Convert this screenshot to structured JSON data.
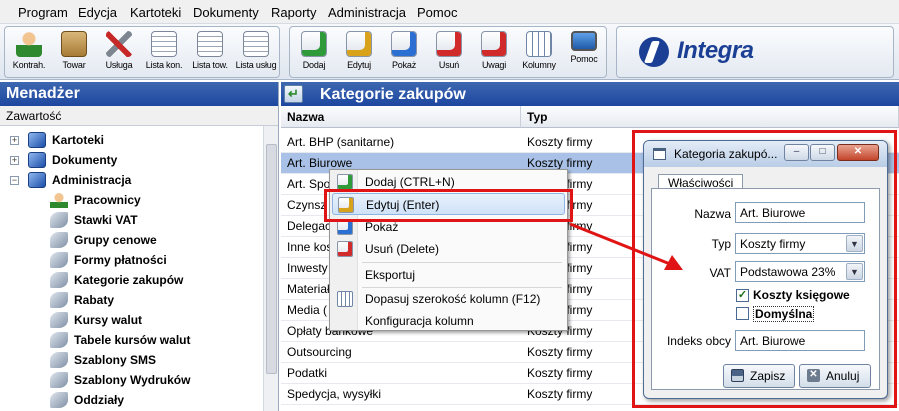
{
  "menubar": {
    "items": [
      "Program",
      "Edycja",
      "Kartoteki",
      "Dokumenty",
      "Raporty",
      "Administracja",
      "Pomoc"
    ]
  },
  "toolbar": {
    "group1": [
      {
        "label": "Kontrah.",
        "icon": "contractor-person-icon"
      },
      {
        "label": "Towar",
        "icon": "goods-box-icon"
      },
      {
        "label": "Usługa",
        "icon": "service-tools-icon"
      },
      {
        "label": "Lista kon.",
        "icon": "contractor-list-icon"
      },
      {
        "label": "Lista tow.",
        "icon": "goods-list-icon"
      },
      {
        "label": "Lista usług",
        "icon": "service-list-icon"
      }
    ],
    "group2": [
      {
        "label": "Dodaj",
        "icon": "add-icon"
      },
      {
        "label": "Edytuj",
        "icon": "edit-icon"
      },
      {
        "label": "Pokaż",
        "icon": "show-icon"
      },
      {
        "label": "Usuń",
        "icon": "delete-icon"
      },
      {
        "label": "Uwagi",
        "icon": "notes-icon"
      },
      {
        "label": "Kolumny",
        "icon": "columns-icon"
      },
      {
        "label": "Pomoc",
        "icon": "help-monitor-icon"
      }
    ],
    "brand": "Integra"
  },
  "left_panel": {
    "title": "Menadżer",
    "subtitle": "Zawartość",
    "tree": [
      {
        "label": "Kartoteki",
        "level": 0,
        "expander": "+"
      },
      {
        "label": "Dokumenty",
        "level": 0,
        "expander": "+"
      },
      {
        "label": "Administracja",
        "level": 0,
        "expander": "−"
      },
      {
        "label": "Pracownicy",
        "level": 1
      },
      {
        "label": "Stawki VAT",
        "level": 1
      },
      {
        "label": "Grupy cenowe",
        "level": 1
      },
      {
        "label": "Formy płatności",
        "level": 1
      },
      {
        "label": "Kategorie zakupów",
        "level": 1
      },
      {
        "label": "Rabaty",
        "level": 1
      },
      {
        "label": "Kursy walut",
        "level": 1
      },
      {
        "label": "Tabele kursów walut",
        "level": 1
      },
      {
        "label": "Szablony SMS",
        "level": 1
      },
      {
        "label": "Szablony Wydruków",
        "level": 1
      },
      {
        "label": "Oddziały",
        "level": 1
      }
    ]
  },
  "right_panel": {
    "title": "Kategorie zakupów",
    "columns": [
      "Nazwa",
      "Typ"
    ],
    "rows": [
      {
        "name": "Art. BHP (sanitarne)",
        "type": "Koszty firmy"
      },
      {
        "name": "Art. Biurowe",
        "type": "Koszty firmy",
        "selected": true
      },
      {
        "name": "Art. Spo",
        "type": "Koszty firmy"
      },
      {
        "name": "Czynsz",
        "type": "Koszty firmy"
      },
      {
        "name": "Delegac",
        "type": "Koszty firmy"
      },
      {
        "name": "Inne kos",
        "type": "Koszty firmy"
      },
      {
        "name": "Inwesty",
        "type": "Koszty firmy"
      },
      {
        "name": "Materiał",
        "type": "Koszty firmy"
      },
      {
        "name": "Media (",
        "type": "Koszty firmy"
      },
      {
        "name": "Opłaty bankowe",
        "type": "Koszty firmy"
      },
      {
        "name": "Outsourcing",
        "type": "Koszty firmy"
      },
      {
        "name": "Podatki",
        "type": "Koszty firmy"
      },
      {
        "name": "Spedycja, wysyłki",
        "type": "Koszty firmy"
      }
    ]
  },
  "context_menu": {
    "items": [
      {
        "label": "Dodaj (CTRL+N)",
        "icon": "add-icon",
        "caption": "Dodaj"
      },
      {
        "label": "Edytuj (Enter)",
        "icon": "edit-icon",
        "caption": "Edytuj",
        "highlighted": true
      },
      {
        "label": "Pokaż",
        "icon": "show-icon",
        "caption": "Pokaż"
      },
      {
        "label": "Usuń (Delete)",
        "icon": "delete-icon",
        "caption": "Usuń"
      },
      {
        "label": "Eksportuj",
        "icon": "",
        "caption": ""
      },
      {
        "label": "Dopasuj szerokość kolumn (F12)",
        "icon": "columns-icon",
        "caption": "Kolumny"
      },
      {
        "label": "Konfiguracja kolumn",
        "icon": "",
        "caption": ""
      }
    ]
  },
  "dialog": {
    "title": "Kategoria zakupó...",
    "tab": "Właściwości",
    "fields": {
      "nazwa_label": "Nazwa",
      "nazwa_value": "Art. Biurowe",
      "typ_label": "Typ",
      "typ_value": "Koszty firmy",
      "vat_label": "VAT",
      "vat_value": "Podstawowa 23%",
      "koszty_label": "Koszty księgowe",
      "koszty_checked": true,
      "domyslna_label": "Domyślna",
      "domyslna_checked": false,
      "indeks_label": "Indeks obcy",
      "indeks_value": "Art. Biurowe"
    },
    "buttons": {
      "save": "Zapisz",
      "cancel": "Anuluj"
    }
  },
  "colors": {
    "header_blue": "#1d47a0",
    "selection": "#a9c1e6",
    "annotation_red": "#e01414",
    "brand_blue": "#1b3f94"
  }
}
